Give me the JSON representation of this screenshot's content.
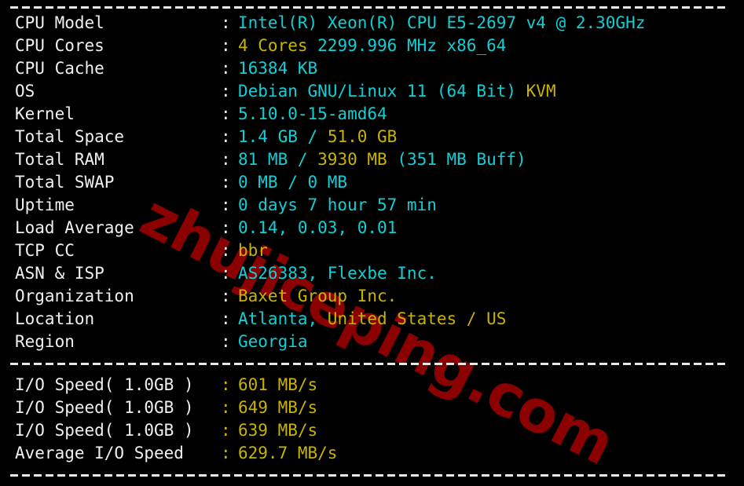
{
  "watermark": {
    "text": "zhujiceping.com",
    "color": "#8B0000",
    "rotation_deg": 27
  },
  "theme": {
    "background": "#000000",
    "label_color": "#f0f0f0",
    "value_cyan": "#12cfd6",
    "value_yellow": "#c8b400",
    "rule_color": "#e8e8e8"
  },
  "separators": {
    "top": "------------------------------",
    "middle": "------------------------------",
    "bottom": "------------------------------"
  },
  "system_info": {
    "rows": [
      {
        "label": "CPU Model",
        "colon": ":",
        "segments": [
          {
            "text": "Intel(R) Xeon(R) CPU E5-2697 v4 @ 2.30GHz",
            "color": "cyan"
          }
        ]
      },
      {
        "label": "CPU Cores",
        "colon": ":",
        "segments": [
          {
            "text": "4 Cores ",
            "color": "yellow"
          },
          {
            "text": "2299.996 MHz x86_64",
            "color": "cyan"
          }
        ]
      },
      {
        "label": "CPU Cache",
        "colon": ":",
        "segments": [
          {
            "text": "16384 KB",
            "color": "cyan"
          }
        ]
      },
      {
        "label": "OS",
        "colon": ":",
        "segments": [
          {
            "text": "Debian GNU/Linux 11 (64 Bit) ",
            "color": "cyan"
          },
          {
            "text": "KVM",
            "color": "yellow"
          }
        ]
      },
      {
        "label": "Kernel",
        "colon": ":",
        "segments": [
          {
            "text": "5.10.0-15-amd64",
            "color": "cyan"
          }
        ]
      },
      {
        "label": "Total Space",
        "colon": ":",
        "segments": [
          {
            "text": "1.4 GB ",
            "color": "cyan"
          },
          {
            "text": "/ ",
            "color": "cyan"
          },
          {
            "text": "51.0 GB",
            "color": "yellow"
          }
        ]
      },
      {
        "label": "Total RAM",
        "colon": ":",
        "segments": [
          {
            "text": "81 MB ",
            "color": "cyan"
          },
          {
            "text": "/ ",
            "color": "cyan"
          },
          {
            "text": "3930 MB ",
            "color": "yellow"
          },
          {
            "text": "(351 MB Buff)",
            "color": "cyan"
          }
        ]
      },
      {
        "label": "Total SWAP",
        "colon": ":",
        "segments": [
          {
            "text": "0 MB / 0 MB",
            "color": "cyan"
          }
        ]
      },
      {
        "label": "Uptime",
        "colon": ":",
        "segments": [
          {
            "text": "0 days 7 hour 57 min",
            "color": "cyan"
          }
        ]
      },
      {
        "label": "Load Average",
        "colon": ":",
        "segments": [
          {
            "text": "0.14, 0.03, 0.01",
            "color": "cyan"
          }
        ]
      },
      {
        "label": "TCP CC",
        "colon": ":",
        "segments": [
          {
            "text": "bbr",
            "color": "yellow"
          }
        ]
      },
      {
        "label": "ASN & ISP",
        "colon": ":",
        "segments": [
          {
            "text": "AS26383, Flexbe Inc.",
            "color": "cyan"
          }
        ]
      },
      {
        "label": "Organization",
        "colon": ":",
        "segments": [
          {
            "text": "Baxet Group Inc.",
            "color": "yellow"
          }
        ]
      },
      {
        "label": "Location",
        "colon": ":",
        "segments": [
          {
            "text": "Atlanta, ",
            "color": "cyan"
          },
          {
            "text": "United States / US",
            "color": "yellow"
          }
        ]
      },
      {
        "label": "Region",
        "colon": ":",
        "segments": [
          {
            "text": "Georgia",
            "color": "cyan"
          }
        ]
      }
    ]
  },
  "io_benchmark": {
    "rows": [
      {
        "label": "I/O Speed( 1.0GB )",
        "colon": ":",
        "segments": [
          {
            "text": "601 MB/s",
            "color": "yellow"
          }
        ]
      },
      {
        "label": "I/O Speed( 1.0GB )",
        "colon": ":",
        "segments": [
          {
            "text": "649 MB/s",
            "color": "yellow"
          }
        ]
      },
      {
        "label": "I/O Speed( 1.0GB )",
        "colon": ":",
        "segments": [
          {
            "text": "639 MB/s",
            "color": "yellow"
          }
        ]
      },
      {
        "label": "Average I/O Speed",
        "colon": ":",
        "segments": [
          {
            "text": "629.7 MB/s",
            "color": "yellow"
          }
        ]
      }
    ]
  }
}
